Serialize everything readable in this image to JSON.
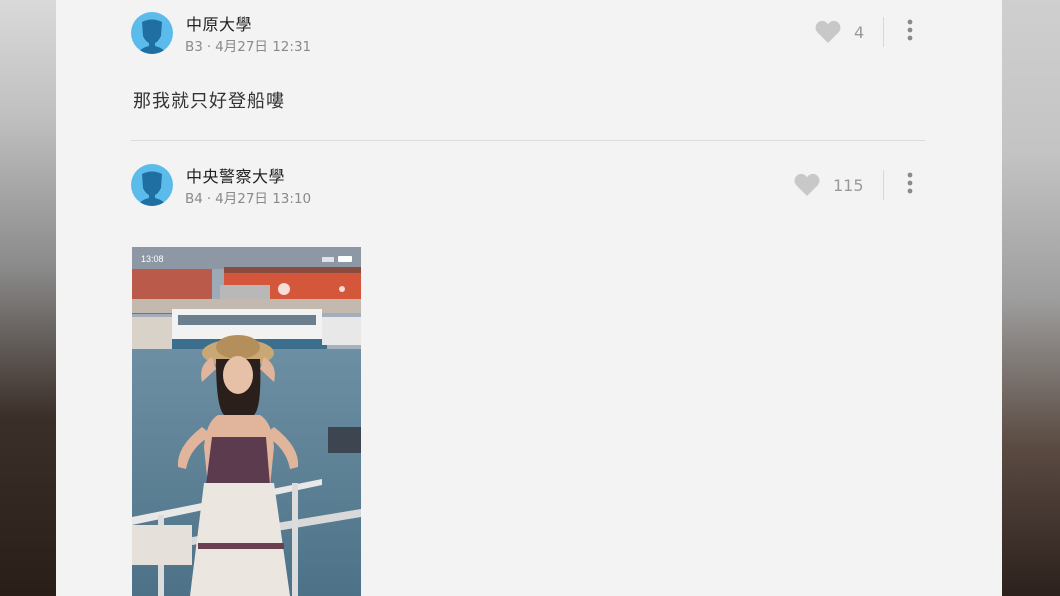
{
  "posts": [
    {
      "author": "中原大學",
      "floor": "B3",
      "date": "4月27日 12:31",
      "likes": "4",
      "content": "那我就只好登船嘍"
    },
    {
      "author": "中央警察大學",
      "floor": "B4",
      "date": "4月27日 13:10",
      "likes": "115",
      "image": {
        "status_time": "13:08"
      }
    }
  ],
  "icons": {
    "avatar": "person-silhouette-icon",
    "like": "heart-icon",
    "more": "more-vertical-icon"
  },
  "colors": {
    "avatar_bg": "#5bbcec",
    "heart": "#c8c8c8",
    "panel_bg": "#f3f3f3"
  }
}
